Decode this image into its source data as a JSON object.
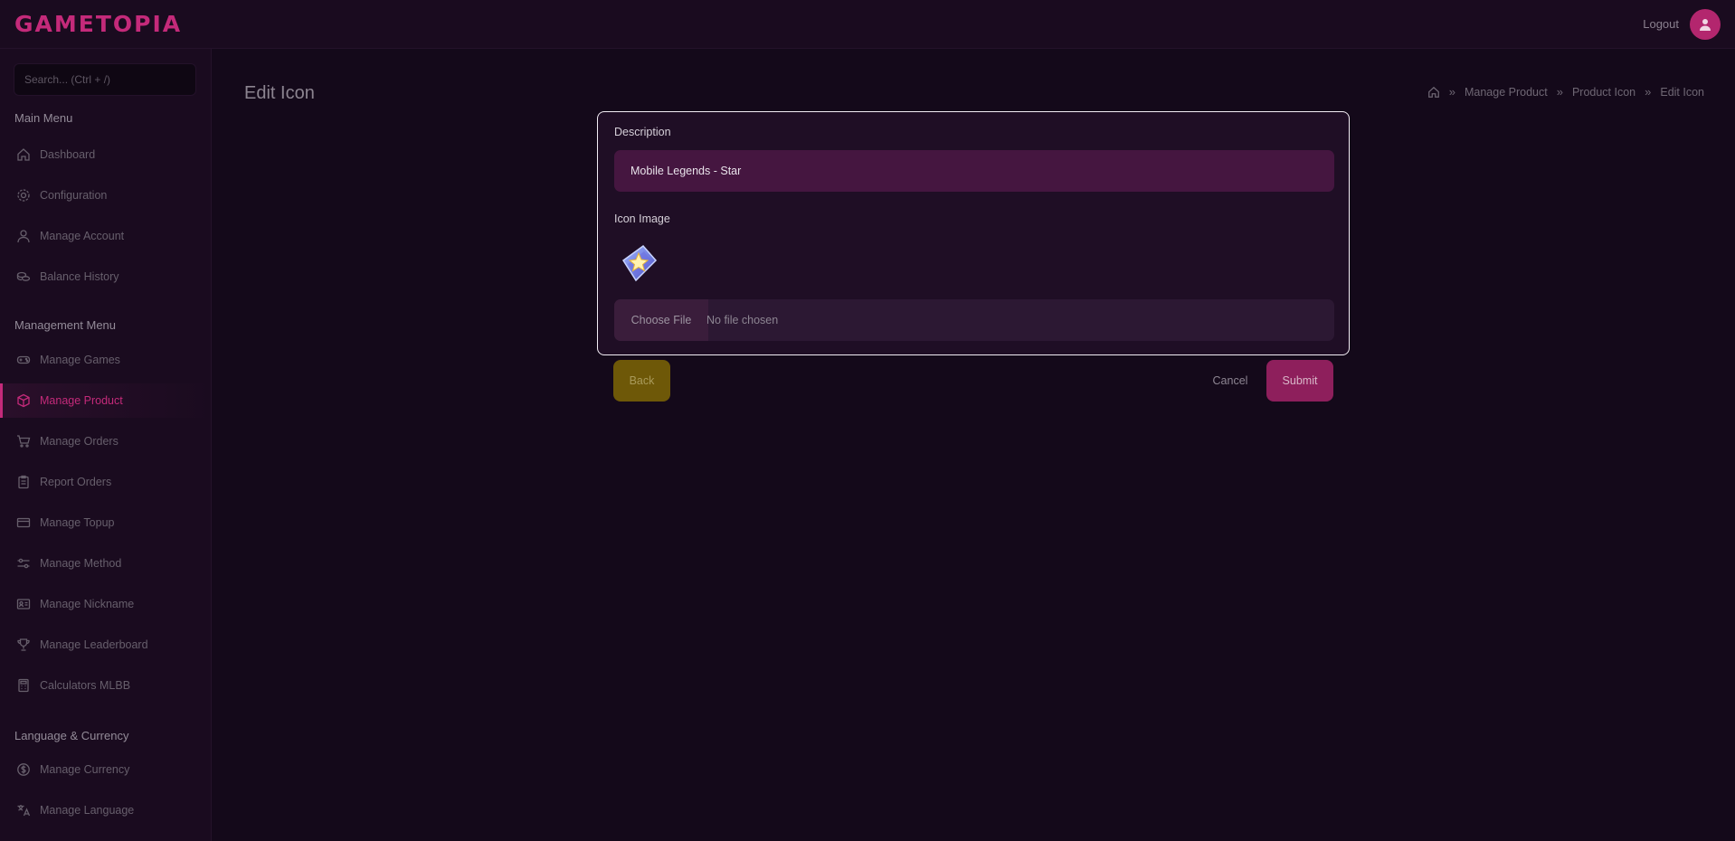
{
  "app": {
    "logo": "GAMETOPIA",
    "logout_label": "Logout",
    "accent": "#c42a7a"
  },
  "sidebar": {
    "search_placeholder": "Search... (Ctrl + /)",
    "main_menu_heading": "Main Menu",
    "main_items": [
      {
        "label": "Dashboard",
        "icon": "home-icon"
      },
      {
        "label": "Configuration",
        "icon": "gear-icon"
      },
      {
        "label": "Manage Account",
        "icon": "user-icon"
      },
      {
        "label": "Balance History",
        "icon": "coins-icon"
      }
    ],
    "management_heading": "Management Menu",
    "management_items": [
      {
        "label": "Manage Games",
        "icon": "gamepad-icon"
      },
      {
        "label": "Manage Product",
        "icon": "box-icon",
        "active": true
      },
      {
        "label": "Manage Orders",
        "icon": "cart-icon"
      },
      {
        "label": "Report Orders",
        "icon": "clipboard-icon"
      },
      {
        "label": "Manage Topup",
        "icon": "card-icon"
      },
      {
        "label": "Manage Method",
        "icon": "sliders-icon"
      },
      {
        "label": "Manage Nickname",
        "icon": "id-card-icon"
      },
      {
        "label": "Manage Leaderboard",
        "icon": "trophy-icon"
      },
      {
        "label": "Calculators MLBB",
        "icon": "calculator-icon"
      }
    ],
    "language_heading": "Language & Currency",
    "language_items": [
      {
        "label": "Manage Currency",
        "icon": "dollar-circle-icon"
      },
      {
        "label": "Manage Language",
        "icon": "translate-icon"
      }
    ]
  },
  "main": {
    "page_title": "Edit Icon",
    "breadcrumb": [
      "Manage Product",
      "Product Icon",
      "Edit Icon"
    ],
    "form": {
      "description_label": "Description",
      "description_value": "Mobile Legends - Star",
      "icon_image_label": "Icon Image",
      "choose_file_label": "Choose File",
      "no_file_text": "No file chosen"
    },
    "actions": {
      "back": "Back",
      "cancel": "Cancel",
      "submit": "Submit"
    }
  }
}
